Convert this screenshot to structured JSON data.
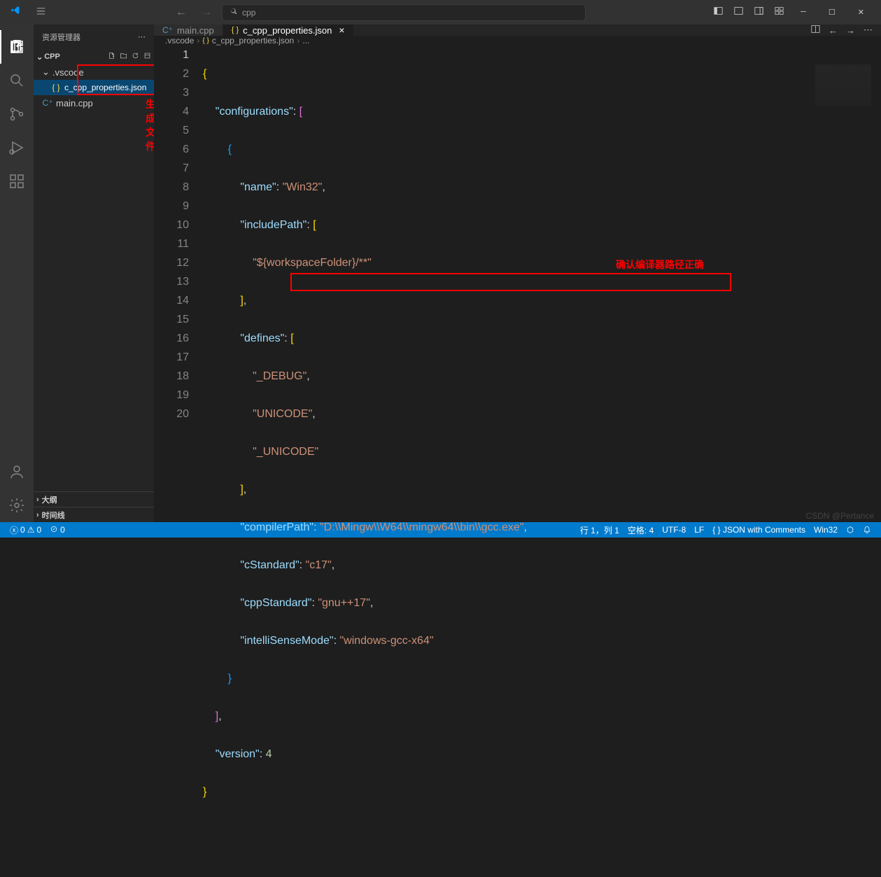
{
  "titlebar": {
    "search_text": "cpp"
  },
  "sidebar": {
    "title": "资源管理器",
    "root": "CPP",
    "folder_vscode": ".vscode",
    "file_properties": "c_cpp_properties.json",
    "file_main": "main.cpp",
    "outline": "大纲",
    "timeline": "时间线"
  },
  "tabs": {
    "main": "main.cpp",
    "properties": "c_cpp_properties.json"
  },
  "breadcrumbs": {
    "folder": ".vscode",
    "file": "c_cpp_properties.json",
    "more": "..."
  },
  "code": {
    "lines": [
      "1",
      "2",
      "3",
      "4",
      "5",
      "6",
      "7",
      "8",
      "9",
      "10",
      "11",
      "12",
      "13",
      "14",
      "15",
      "16",
      "17",
      "18",
      "19",
      "20"
    ],
    "k_configurations": "\"configurations\"",
    "k_name": "\"name\"",
    "v_name": "\"Win32\"",
    "k_includePath": "\"includePath\"",
    "v_includePath": "\"${workspaceFolder}/**\"",
    "k_defines": "\"defines\"",
    "v_debug": "\"_DEBUG\"",
    "v_unicode": "\"UNICODE\"",
    "v_unicode2": "\"_UNICODE\"",
    "k_compilerPath": "\"compilerPath\"",
    "v_compilerPath": "\"D:\\\\Mingw\\\\W64\\\\mingw64\\\\bin\\\\gcc.exe\"",
    "k_cStandard": "\"cStandard\"",
    "v_cStandard": "\"c17\"",
    "k_cppStandard": "\"cppStandard\"",
    "v_cppStandard": "\"gnu++17\"",
    "k_intelliSenseMode": "\"intelliSenseMode\"",
    "v_intelliSenseMode": "\"windows-gcc-x64\"",
    "k_version": "\"version\"",
    "v_version": "4"
  },
  "annotations": {
    "gen_file": "生成文件",
    "compiler_path": "确认编译器路径正确"
  },
  "statusbar": {
    "errors": "0",
    "warnings": "0",
    "ports": "0",
    "position": "行 1，列 1",
    "spaces": "空格: 4",
    "encoding": "UTF-8",
    "eol": "LF",
    "lang": "{ }  JSON with Comments",
    "platform": "Win32"
  },
  "watermark": "CSDN @Pertance"
}
